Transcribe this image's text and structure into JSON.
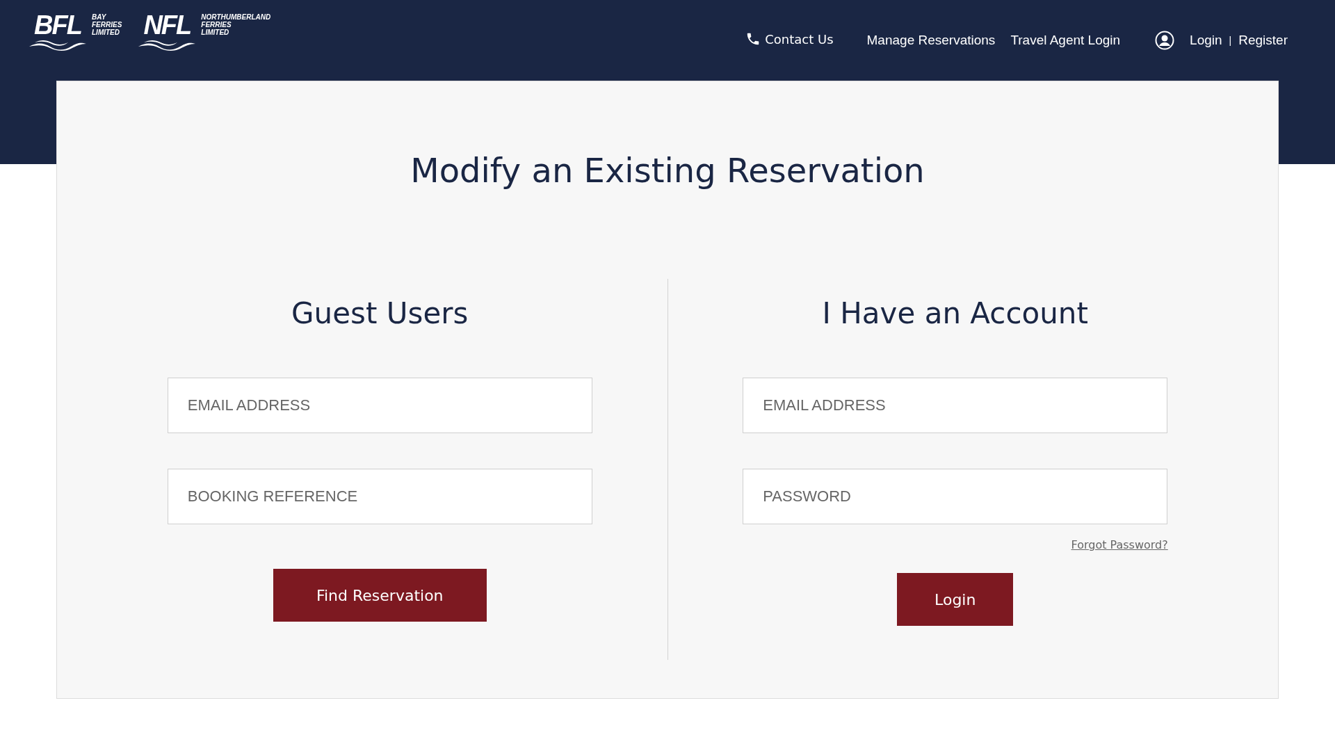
{
  "header": {
    "logos": [
      {
        "mark": "BFL",
        "lines": [
          "BAY",
          "FERRIES",
          "LIMITED"
        ]
      },
      {
        "mark": "NFL",
        "lines": [
          "NORTHUMBERLAND",
          "FERRIES",
          "LIMITED"
        ]
      }
    ],
    "contact": "Contact Us",
    "nav": [
      "Manage Reservations",
      "Travel Agent Login"
    ],
    "login": "Login",
    "separator": "|",
    "register": "Register"
  },
  "page": {
    "title": "Modify an Existing Reservation",
    "guest": {
      "heading": "Guest Users",
      "fields": [
        {
          "placeholder": "EMAIL ADDRESS"
        },
        {
          "placeholder": "BOOKING REFERENCE"
        }
      ],
      "button": "Find Reservation"
    },
    "account": {
      "heading": "I Have an Account",
      "fields": [
        {
          "placeholder": "EMAIL ADDRESS"
        },
        {
          "placeholder": "PASSWORD"
        }
      ],
      "forgot": "Forgot Password?",
      "button": "Login"
    }
  }
}
